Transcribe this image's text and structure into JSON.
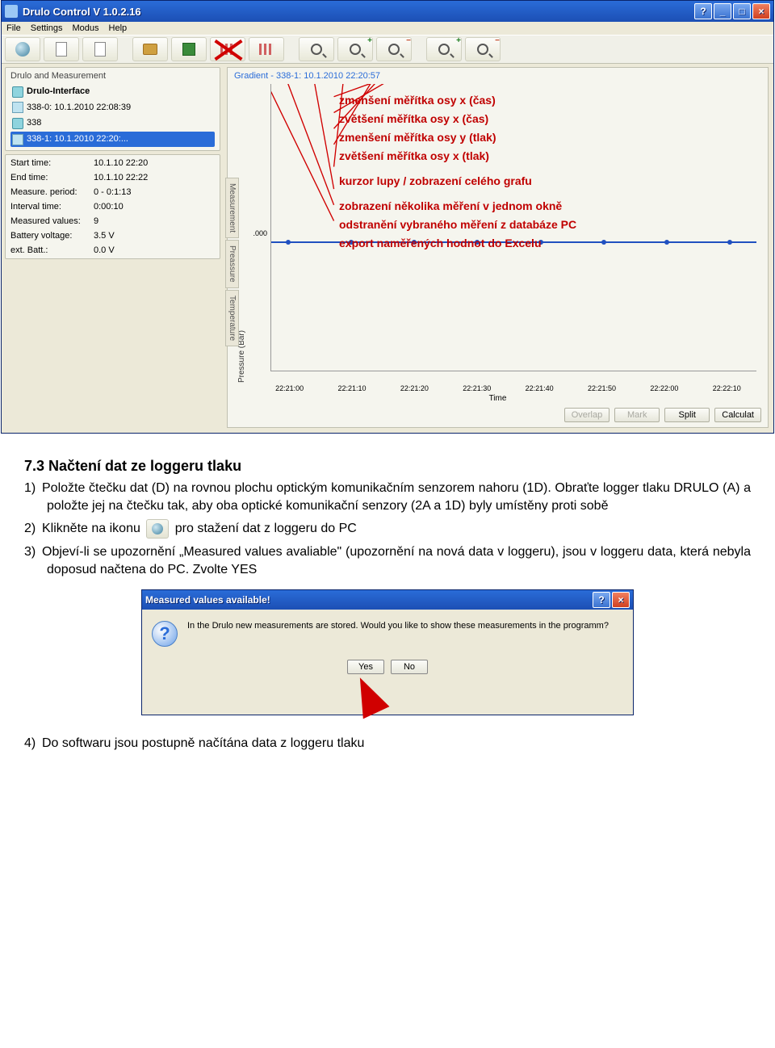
{
  "window": {
    "title": "Drulo Control V 1.0.2.16"
  },
  "menu": {
    "file": "File",
    "settings": "Settings",
    "modus": "Modus",
    "help": "Help"
  },
  "panels": {
    "left_title": "Drulo and Measurement",
    "tree": {
      "root": "Drulo-Interface",
      "n1": "338-0: 10.1.2010 22:08:39",
      "n2": "338",
      "n3": "338-1: 10.1.2010 22:20:..."
    },
    "info": {
      "start_k": "Start time:",
      "start_v": "10.1.10 22:20",
      "end_k": "End time:",
      "end_v": "10.1.10 22:22",
      "meas_k": "Measure. period:",
      "meas_v": "0 - 0:1:13",
      "ivl_k": "Interval time:",
      "ivl_v": "0:00:10",
      "mv_k": "Measured values:",
      "mv_v": "9",
      "bv_k": "Battery voltage:",
      "bv_v": "3.5 V",
      "eb_k": "ext. Batt.:",
      "eb_v": "0.0 V"
    }
  },
  "chart": {
    "header": "Gradient - 338-1: 10.1.2010 22:20:57",
    "ylabel": "Pressure (Bar)",
    "ytick": ".000",
    "xlabel": "Time"
  },
  "chart_data": {
    "type": "line",
    "x": [
      "22:21:00",
      "22:21:10",
      "22:21:20",
      "22:21:30",
      "22:21:40",
      "22:21:50",
      "22:22:00",
      "22:22:10"
    ],
    "values": [
      0.0,
      0.0,
      0.0,
      0.0,
      0.0,
      0.0,
      0.0,
      0.0
    ],
    "title": "Gradient - 338-1: 10.1.2010 22:20:57",
    "xlabel": "Time",
    "ylabel": "Pressure (Bar)",
    "ylim": [
      0,
      0
    ]
  },
  "sidetabs": {
    "t1": "Measurement",
    "t2": "Preassure",
    "t3": "Temperature"
  },
  "chart_buttons": {
    "overlap": "Overlap",
    "mark": "Mark",
    "split": "Split",
    "calc": "Calculat"
  },
  "annotations": {
    "l1": "zmenšení měřítka osy x (čas)",
    "l2": "zvětšení měřítka osy x (čas)",
    "l3": "zmenšení měřítka osy y (tlak)",
    "l4": "zvětšení měřítka osy x (tlak)",
    "l5": "kurzor lupy / zobrazení celého grafu",
    "l6": "zobrazení několika měření v jednom okně",
    "l7": "odstranění vybraného měření z databáze PC",
    "l8": "export naměřených hodnot do Excelu"
  },
  "doc": {
    "heading": "7.3 Načtení dat ze loggeru tlaku",
    "step1": "Položte čtečku dat (D) na rovnou plochu optickým komunikačním senzorem nahoru (1D). Obraťte logger tlaku DRULO (A) a položte jej na čtečku tak, aby oba optické komunikační senzory (2A a 1D) byly umístěny proti sobě",
    "step2a": "Klikněte na ikonu",
    "step2b": "pro stažení dat z loggeru do PC",
    "step3": "Objeví-li se upozornění „Measured values avaliable\" (upozornění na nová data v loggeru), jsou v loggeru data, která nebyla doposud načtena do PC. Zvolte YES",
    "step4": "Do softwaru jsou postupně načítána data z loggeru tlaku"
  },
  "dialog": {
    "title": "Measured values available!",
    "msg": "In the Drulo new measurements are stored. Would you like to show these measurements in the programm?",
    "yes": "Yes",
    "no": "No"
  }
}
